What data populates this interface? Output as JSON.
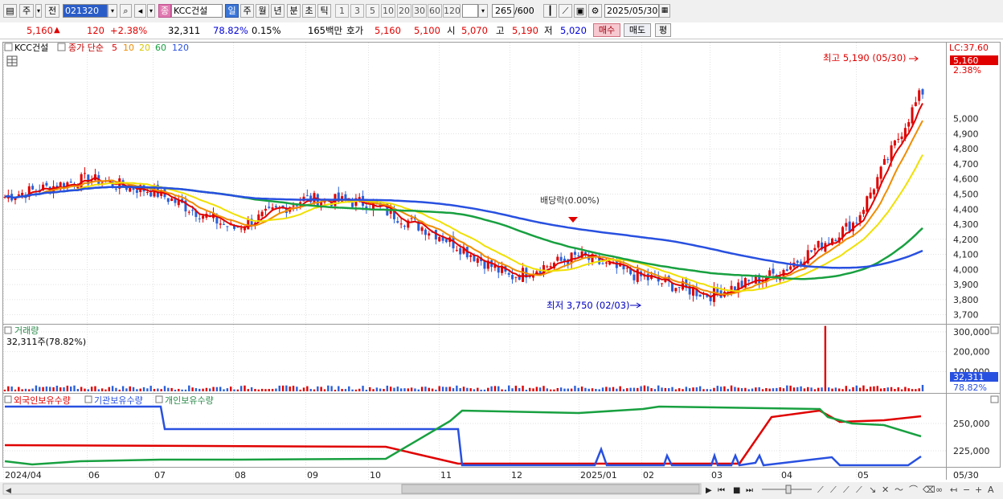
{
  "toolbar": {
    "mode_primary": "주",
    "mode_secondary": "전",
    "stock_code": "021320",
    "stock_name": "KCC건설",
    "period_active": "일",
    "periods": [
      "주",
      "월",
      "년",
      "분",
      "초",
      "틱"
    ],
    "intervals": [
      "1",
      "3",
      "5",
      "10",
      "20",
      "30",
      "60",
      "120"
    ],
    "count_display": "265",
    "count_total": "/600",
    "date": "2025/05/30",
    "type_badge": "종"
  },
  "quote": {
    "price": "5,160",
    "change_arrow": "▲",
    "change": "120",
    "change_rate": "+2.38%",
    "volume": "32,311",
    "volume_ratio": "78.82%",
    "turnover": "0.15%",
    "trade_amount": "165백만",
    "ask_label": "호가",
    "ask_price": "5,160",
    "bid_price": "5,100",
    "open_label": "시",
    "open": "5,070",
    "high_label": "고",
    "high": "5,190",
    "low_label": "저",
    "low": "5,020",
    "buy_label": "매수",
    "sell_label": "매도",
    "avg_label": "평"
  },
  "price_pane": {
    "stock_label": "KCC건설",
    "ma_title": "종가 단순",
    "ma_periods": [
      "5",
      "10",
      "20",
      "60",
      "120"
    ],
    "ma_colors": [
      "#e00000",
      "#f08c00",
      "#f0e000",
      "#18a040",
      "#2850e0"
    ],
    "lc_label": "LC:37.60",
    "current_price_box": "5,160",
    "current_rate": "2.38%",
    "high_annotation": "최고 5,190 (05/30)",
    "low_annotation": "최저 3,750 (02/03)",
    "dividend_annotation": "배당락(0.00%)",
    "y_ticks": [
      "5,000",
      "4,900",
      "4,800",
      "4,700",
      "4,600",
      "4,500",
      "4,400",
      "4,300",
      "4,200",
      "4,100",
      "4,000",
      "3,900",
      "3,800",
      "3,700"
    ]
  },
  "volume_pane": {
    "title": "거래량",
    "value_label": "32,311주(78.82%)",
    "y_ticks": [
      "300,000",
      "200,000",
      "100,000"
    ],
    "current_box": "32,311",
    "current_rate": "78.82%"
  },
  "holdings_pane": {
    "series_labels": [
      "외국인보유수량",
      "기관보유수량",
      "개인보유수량"
    ],
    "series_colors": [
      "#e00000",
      "#2850e0",
      "#2a8a4a"
    ],
    "y_ticks": [
      "250,000",
      "225,000"
    ]
  },
  "x_axis": {
    "labels": [
      "2024/04",
      "06",
      "07",
      "08",
      "09",
      "10",
      "11",
      "12",
      "2025/01",
      "02",
      "03",
      "04",
      "05"
    ],
    "end_label": "05/30"
  },
  "chart_data": {
    "type": "candlestick",
    "symbol": "KCC건설",
    "date_range": [
      "2024/04",
      "2025/05/30"
    ],
    "last": {
      "close": 5160,
      "open": 5070,
      "high": 5190,
      "low": 5020,
      "volume": 32311
    },
    "period_high": {
      "value": 5190,
      "date": "05/30"
    },
    "period_low": {
      "value": 3750,
      "date": "02/03"
    },
    "price_ylim": [
      3700,
      5000
    ],
    "monthly_close_approx": [
      {
        "x": "2024/04",
        "close": 4480
      },
      {
        "x": "05",
        "close": 4600
      },
      {
        "x": "06",
        "close": 4520
      },
      {
        "x": "07",
        "close": 4270
      },
      {
        "x": "08",
        "close": 4470
      },
      {
        "x": "09",
        "close": 4440
      },
      {
        "x": "10",
        "close": 4230
      },
      {
        "x": "11",
        "close": 3950
      },
      {
        "x": "12",
        "close": 4090
      },
      {
        "x": "2025/01",
        "close": 3950
      },
      {
        "x": "02",
        "close": 3830
      },
      {
        "x": "03",
        "close": 3980
      },
      {
        "x": "04",
        "close": 4320
      },
      {
        "x": "05/30",
        "close": 5160
      }
    ],
    "volume_ylim": [
      0,
      300000
    ],
    "volume_spike": {
      "x": "04",
      "value": 330000
    }
  }
}
